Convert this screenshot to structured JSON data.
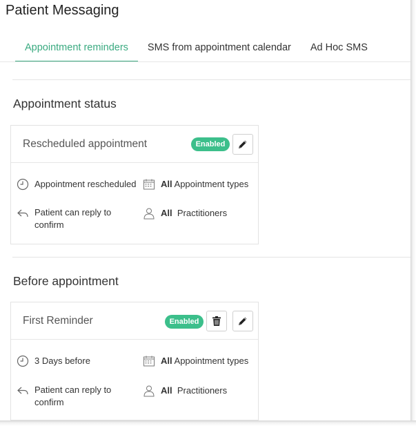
{
  "page": {
    "title": "Patient Messaging"
  },
  "tabs": [
    {
      "label": "Appointment reminders",
      "active": true
    },
    {
      "label": "SMS from appointment calendar",
      "active": false
    },
    {
      "label": "Ad Hoc SMS",
      "active": false
    }
  ],
  "colors": {
    "accent": "#3aaa80",
    "badge": "#3cbf8b"
  },
  "sections": [
    {
      "heading": "Appointment status",
      "card": {
        "title": "Rescheduled appointment",
        "status": "Enabled",
        "actions": [
          "pencil-icon"
        ],
        "trigger": "Appointment rescheduled",
        "reply": "Patient can reply to confirm",
        "appointment_types_prefix": "All",
        "appointment_types": "Appointment types",
        "practitioners_prefix": "All",
        "practitioners": "Practitioners"
      }
    },
    {
      "heading": "Before appointment",
      "card": {
        "title": "First Reminder",
        "status": "Enabled",
        "actions": [
          "trash-icon",
          "pencil-icon"
        ],
        "trigger": "3 Days before",
        "reply": "Patient can reply to confirm",
        "appointment_types_prefix": "All",
        "appointment_types": "Appointment types",
        "practitioners_prefix": "All",
        "practitioners": "Practitioners"
      }
    }
  ]
}
